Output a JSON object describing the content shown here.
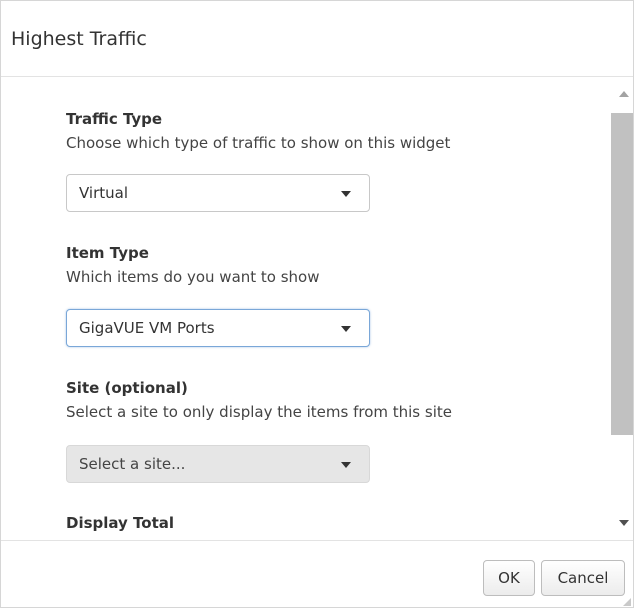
{
  "dialog": {
    "title": "Highest Traffic"
  },
  "fields": {
    "traffic_type": {
      "label": "Traffic Type",
      "description": "Choose which type of traffic to show on this widget",
      "selected": "Virtual"
    },
    "item_type": {
      "label": "Item Type",
      "description": "Which items do you want to show",
      "selected": "GigaVUE VM Ports"
    },
    "site": {
      "label": "Site (optional)",
      "description": "Select a site to only display the items from this site",
      "placeholder": "Select a site..."
    },
    "display_total": {
      "label": "Display Total"
    }
  },
  "footer": {
    "ok_label": "OK",
    "cancel_label": "Cancel"
  },
  "icons": {
    "dropdown": "chevron-down-icon",
    "scroll_up": "arrow-up-icon",
    "scroll_down": "arrow-down-icon",
    "resize": "resize-grip-icon"
  }
}
